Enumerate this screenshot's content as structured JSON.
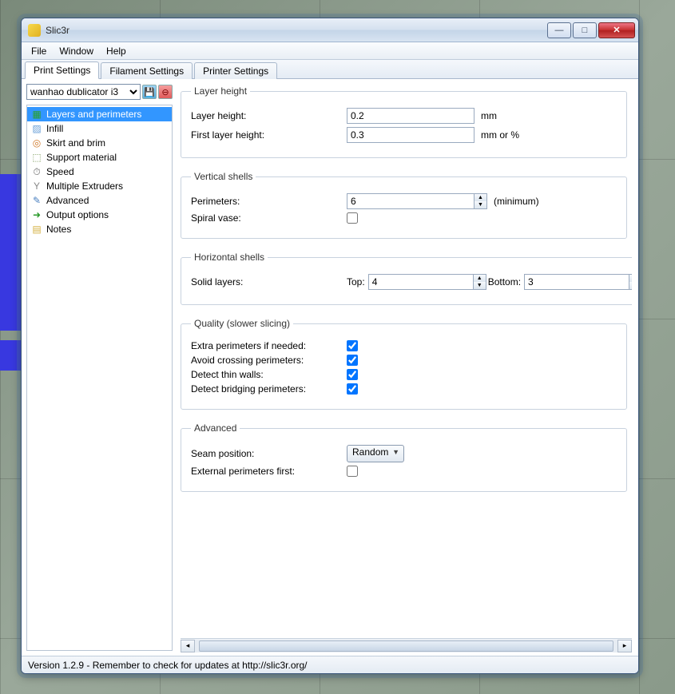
{
  "window": {
    "title": "Slic3r"
  },
  "menu": {
    "file": "File",
    "window": "Window",
    "help": "Help"
  },
  "tabs": [
    {
      "label": "Print Settings",
      "active": true
    },
    {
      "label": "Filament Settings",
      "active": false
    },
    {
      "label": "Printer Settings",
      "active": false
    }
  ],
  "profile": {
    "selected": "wanhao dublicator i3"
  },
  "sidebar": {
    "items": [
      {
        "label": "Layers and perimeters",
        "icon": "▦",
        "color": "#2aa02a",
        "selected": true
      },
      {
        "label": "Infill",
        "icon": "▨",
        "color": "#6aa0d8",
        "selected": false
      },
      {
        "label": "Skirt and brim",
        "icon": "◎",
        "color": "#d07828",
        "selected": false
      },
      {
        "label": "Support material",
        "icon": "⬚",
        "color": "#7a9a5a",
        "selected": false
      },
      {
        "label": "Speed",
        "icon": "⏱",
        "color": "#666",
        "selected": false
      },
      {
        "label": "Multiple Extruders",
        "icon": "Y",
        "color": "#888",
        "selected": false
      },
      {
        "label": "Advanced",
        "icon": "✎",
        "color": "#4a80c0",
        "selected": false
      },
      {
        "label": "Output options",
        "icon": "➜",
        "color": "#2a9a2a",
        "selected": false
      },
      {
        "label": "Notes",
        "icon": "▤",
        "color": "#d4b040",
        "selected": false
      }
    ]
  },
  "groups": {
    "layer_height": {
      "legend": "Layer height",
      "layer_height_label": "Layer height:",
      "layer_height_value": "0.2",
      "layer_height_unit": "mm",
      "first_layer_label": "First layer height:",
      "first_layer_value": "0.3",
      "first_layer_unit": "mm or %"
    },
    "vertical_shells": {
      "legend": "Vertical shells",
      "perimeters_label": "Perimeters:",
      "perimeters_value": "6",
      "perimeters_unit": "(minimum)",
      "spiral_label": "Spiral vase:",
      "spiral_checked": false
    },
    "horizontal_shells": {
      "legend": "Horizontal shells",
      "solid_label": "Solid layers:",
      "top_label": "Top:",
      "top_value": "4",
      "bottom_label": "Bottom:",
      "bottom_value": "3"
    },
    "quality": {
      "legend": "Quality (slower slicing)",
      "extra_label": "Extra perimeters if needed:",
      "extra_checked": true,
      "avoid_label": "Avoid crossing perimeters:",
      "avoid_checked": true,
      "thin_label": "Detect thin walls:",
      "thin_checked": true,
      "bridging_label": "Detect bridging perimeters:",
      "bridging_checked": true
    },
    "advanced": {
      "legend": "Advanced",
      "seam_label": "Seam position:",
      "seam_value": "Random",
      "ext_first_label": "External perimeters first:",
      "ext_first_checked": false
    }
  },
  "status": "Version 1.2.9 - Remember to check for updates at http://slic3r.org/"
}
